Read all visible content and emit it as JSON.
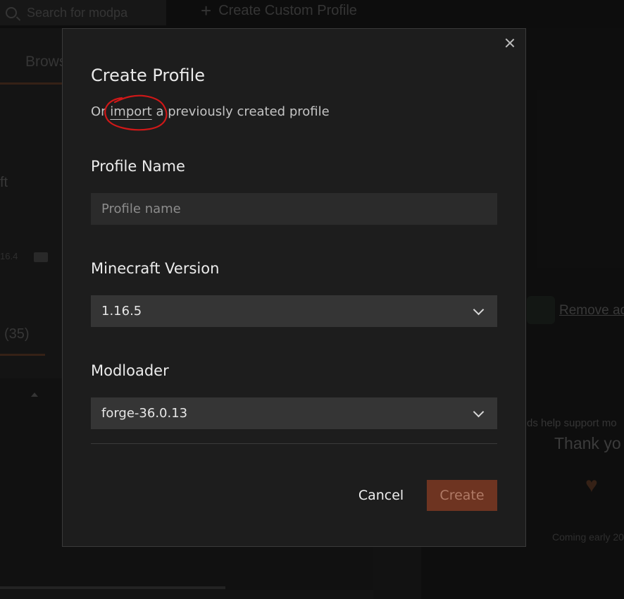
{
  "background": {
    "search_placeholder": "Search for modpa",
    "create_custom_label": "Create Custom Profile",
    "browse_tab": "Brows",
    "project_title_fragment": "ft",
    "version_fragment": "16.4",
    "folder_fragment": "f",
    "count_tab": "(35)",
    "remove_ads_label": "Remove ad",
    "ads_support_text": "ds help support mo",
    "thank_you_text": "Thank yo",
    "coming_text": "Coming early 20"
  },
  "modal": {
    "title": "Create Profile",
    "subtitle_prefix": "Or ",
    "import_link": "import",
    "subtitle_suffix": " a previously created profile",
    "profile_name_label": "Profile Name",
    "profile_name_placeholder": "Profile name",
    "profile_name_value": "",
    "minecraft_version_label": "Minecraft Version",
    "minecraft_version_value": "1.16.5",
    "modloader_label": "Modloader",
    "modloader_value": "forge-36.0.13",
    "cancel_label": "Cancel",
    "create_label": "Create"
  },
  "colors": {
    "accent": "#6e3421",
    "annotation": "#d01818",
    "modal_bg": "#1d1d1d"
  }
}
